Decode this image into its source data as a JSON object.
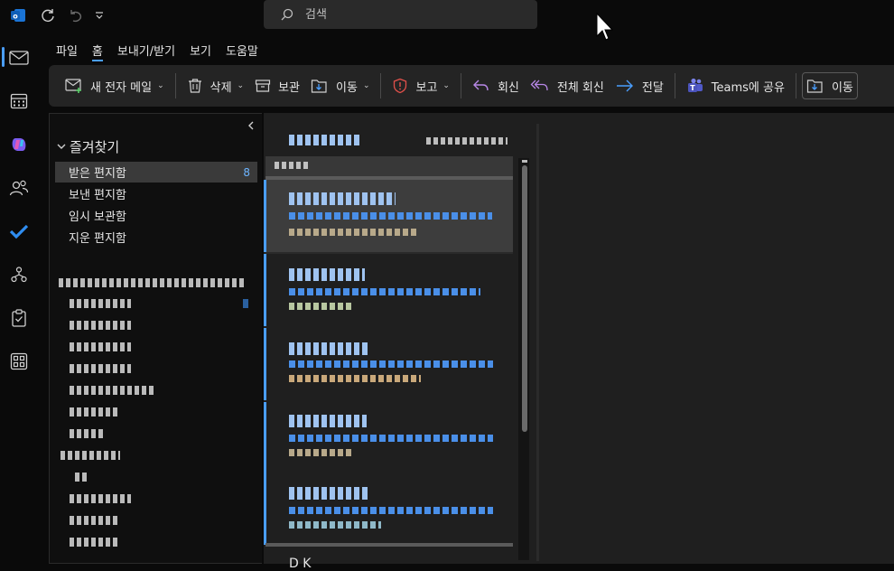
{
  "titlebar": {
    "search_placeholder": "검색"
  },
  "menu": {
    "items": [
      "파일",
      "홈",
      "보내기/받기",
      "보기",
      "도움말"
    ],
    "active": "홈"
  },
  "ribbon": {
    "new_mail": "새 전자 메일",
    "delete": "삭제",
    "archive": "보관",
    "move": "이동",
    "report": "보고",
    "reply": "회신",
    "reply_all": "전체 회신",
    "forward": "전달",
    "teams_share": "Teams에 공유",
    "move2": "이동"
  },
  "nav": {
    "favorites_label": "즐겨찾기",
    "folders": [
      {
        "label": "받은 편지함",
        "count": "8"
      },
      {
        "label": "보낸 편지함",
        "count": ""
      },
      {
        "label": "임시 보관함",
        "count": ""
      },
      {
        "label": "지운 편지함",
        "count": ""
      }
    ]
  },
  "list": {
    "last_sender_partial": "D    K"
  },
  "colors": {
    "accent": "#4a9eff",
    "background": "#0a0a0a",
    "pane": "#1f1f1f",
    "ribbon": "#242424"
  }
}
